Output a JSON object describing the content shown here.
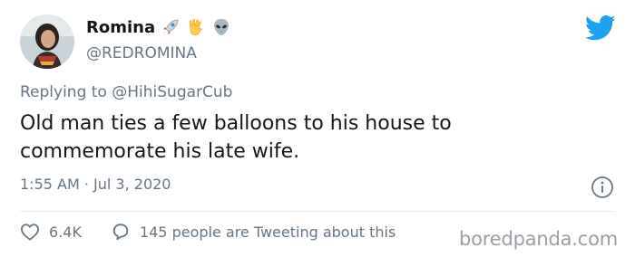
{
  "author": {
    "display_name": "Romina",
    "handle": "@REDROMINA",
    "name_emojis": [
      "rocket-emoji",
      "vulcan-salute-emoji",
      "alien-emoji"
    ]
  },
  "reply": {
    "prefix": "Replying to",
    "mention": "@HihiSugarCub"
  },
  "tweet": {
    "text": "Old man ties a few balloons to his house to commemorate his late wife.",
    "timestamp": "1:55 AM · Jul 3, 2020"
  },
  "actions": {
    "likes": "6.4K",
    "tweeting_about": "145 people are Tweeting about this"
  },
  "watermark": "boredpanda.com",
  "colors": {
    "brand_blue": "#1da1f2",
    "text_primary": "#14171a",
    "text_secondary": "#657786",
    "divider": "#e6ecf0"
  },
  "icons": [
    "twitter-bird-icon",
    "info-icon",
    "heart-icon",
    "speech-bubble-icon"
  ]
}
